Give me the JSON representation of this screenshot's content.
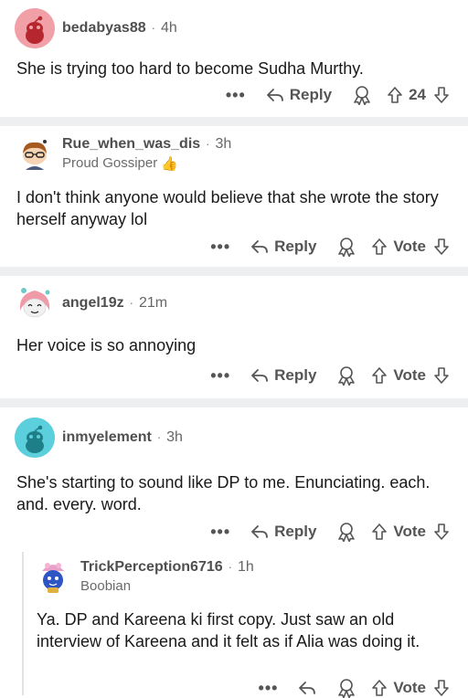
{
  "comments": [
    {
      "username": "bedabyas88",
      "time": "4h",
      "flair": "",
      "text": "She is trying too hard to become Sudha Murthy.",
      "reply_label": "Reply",
      "vote_label": "24",
      "avatar_color": "#f2a0a8"
    },
    {
      "username": "Rue_when_was_dis",
      "time": "3h",
      "flair": "Proud Gossiper",
      "flair_emoji": "👍",
      "text": "I don't think anyone would believe that she wrote the story herself anyway lol",
      "reply_label": "Reply",
      "vote_label": "Vote",
      "avatar_color": "#ffffff"
    },
    {
      "username": "angel19z",
      "time": "21m",
      "flair": "",
      "text": "Her voice is so annoying",
      "reply_label": "Reply",
      "vote_label": "Vote",
      "avatar_color": "#ffffff"
    },
    {
      "username": "inmyelement",
      "time": "3h",
      "flair": "",
      "text": "She's starting to sound like DP to me. Enunciating. each. and. every. word.",
      "reply_label": "Reply",
      "vote_label": "Vote",
      "avatar_color": "#5ccfdc"
    },
    {
      "username": "TrickPerception6716",
      "time": "1h",
      "flair": "Boobian",
      "text": "Ya. DP and Kareena ki first copy. Just saw an old interview of Kareena and it felt as if Alia was doing it.",
      "reply_label": "",
      "vote_label": "Vote",
      "avatar_color": "#ffffff"
    }
  ],
  "more_label": "•••",
  "separator_dot": "·",
  "colors": {
    "separator": "#eeeff1",
    "text": "#1a1a1b",
    "meta": "#666666"
  }
}
